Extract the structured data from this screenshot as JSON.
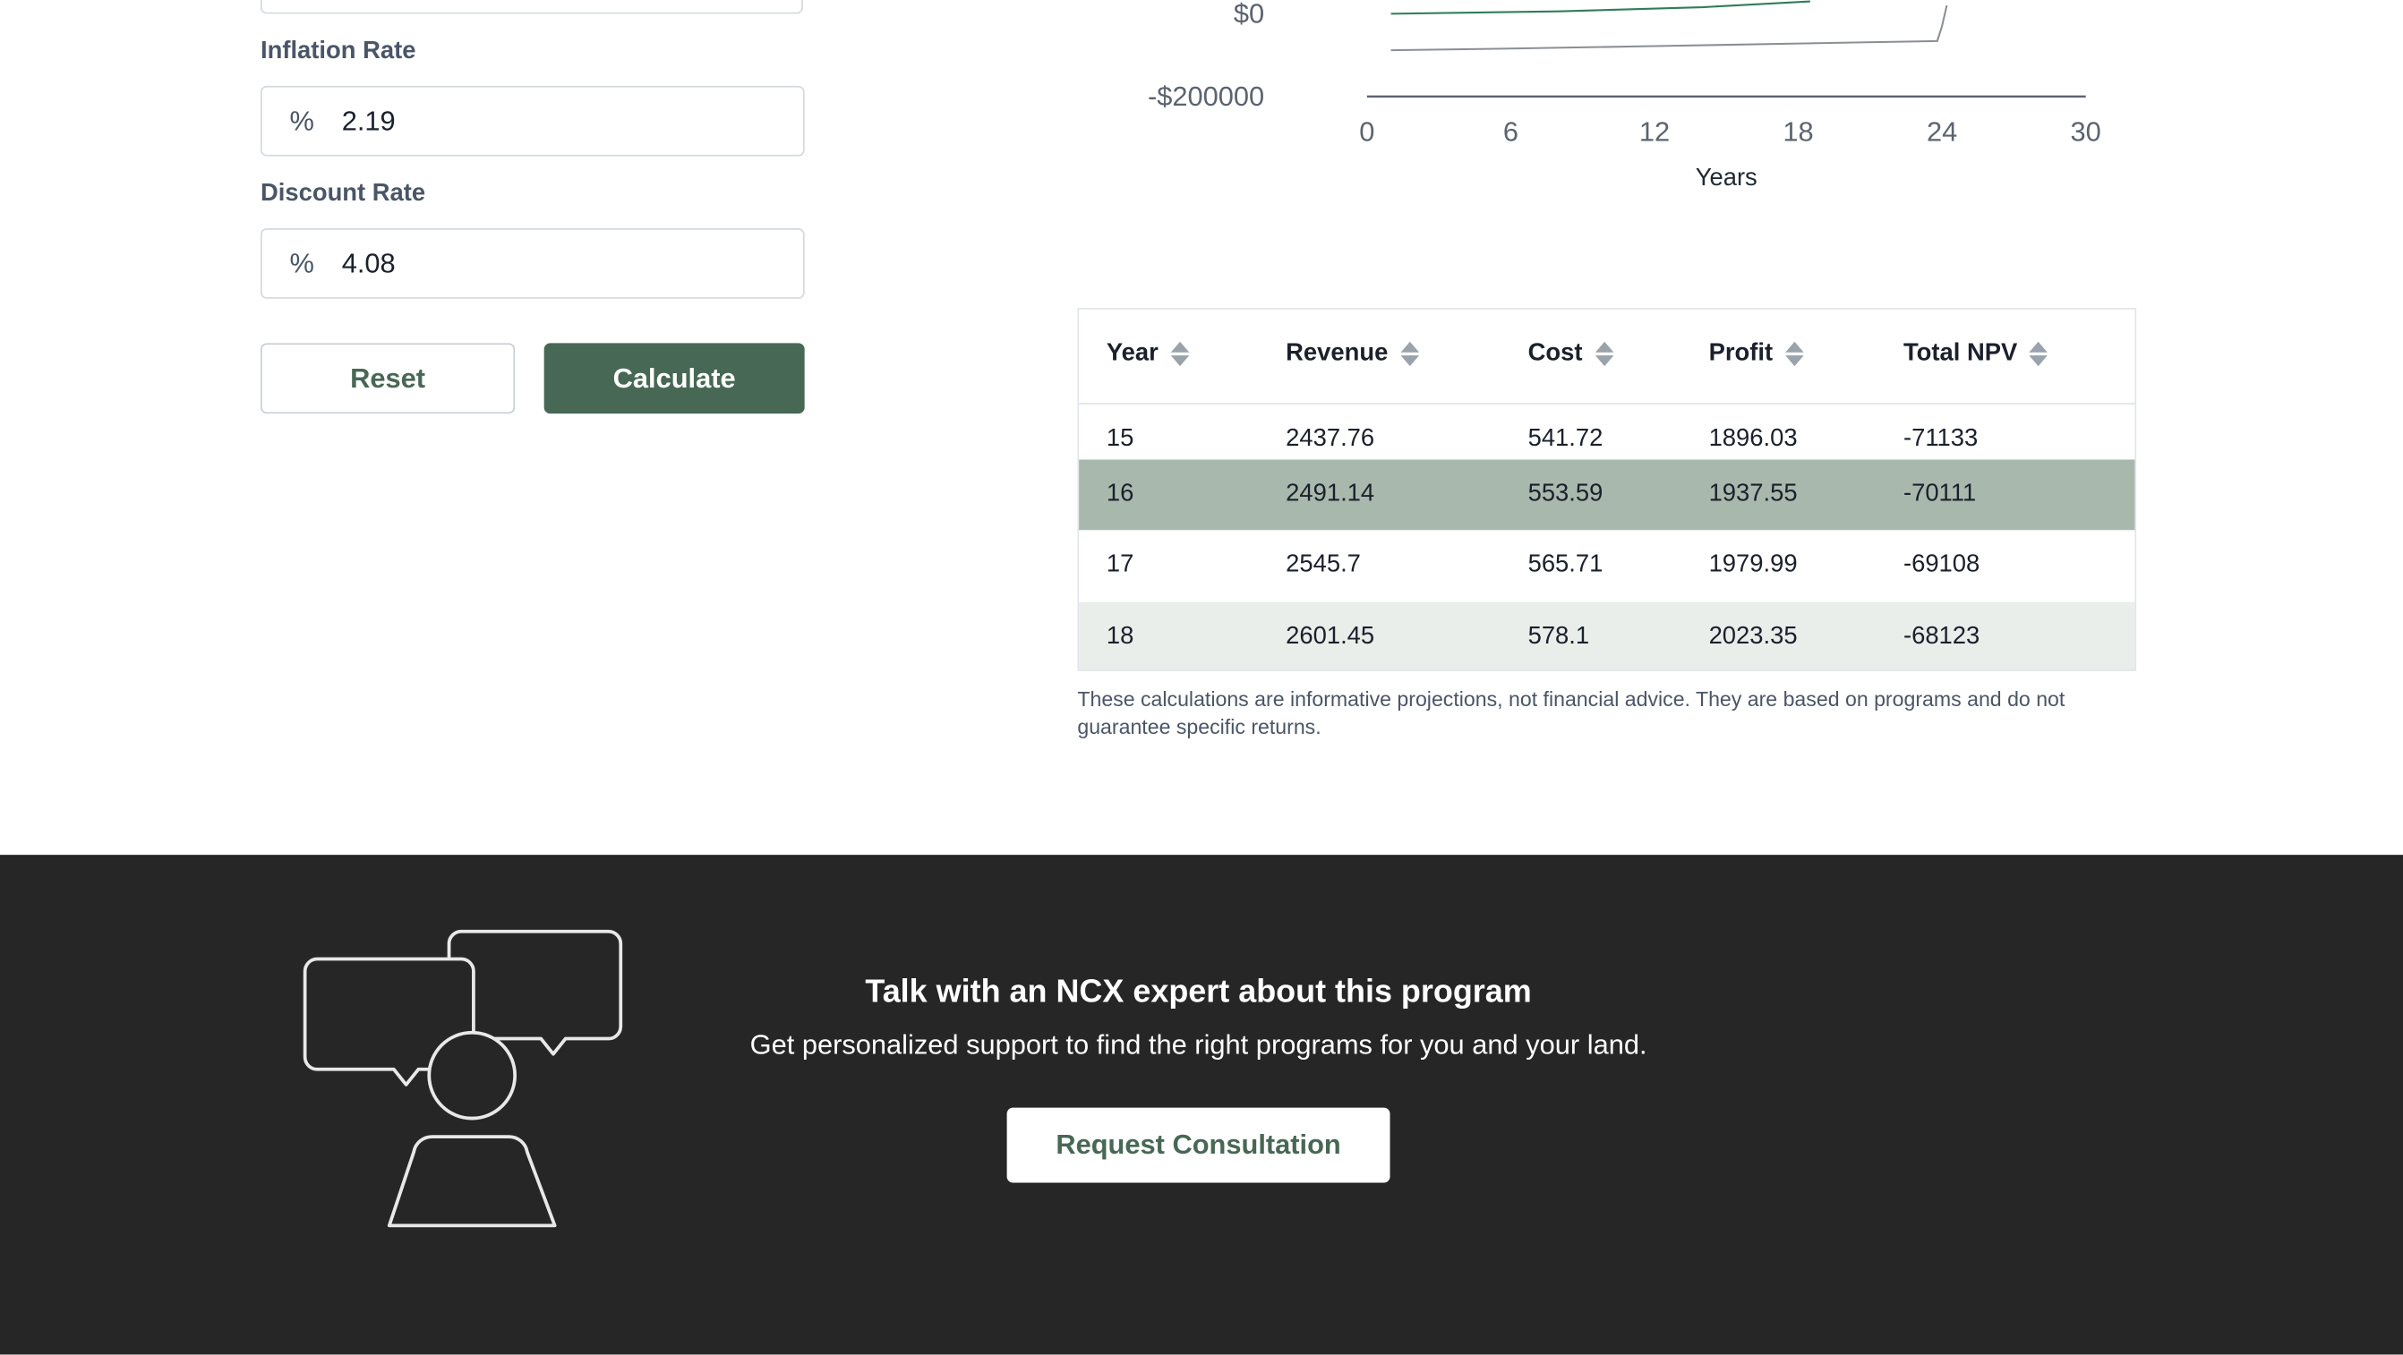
{
  "form": {
    "inflation_label": "Inflation Rate",
    "inflation_unit": "%",
    "inflation_value": "2.19",
    "discount_label": "Discount Rate",
    "discount_unit": "%",
    "discount_value": "4.08",
    "reset_label": "Reset",
    "calculate_label": "Calculate"
  },
  "chart_data": {
    "type": "line",
    "xlabel": "Years",
    "ylabel": "",
    "x_ticks": [
      "0",
      "6",
      "12",
      "18",
      "24",
      "30"
    ],
    "y_ticks_visible": [
      "$0",
      "-$200000"
    ],
    "xlim": [
      0,
      30
    ],
    "series": [
      {
        "color": "#2f7d5b",
        "x": [
          1,
          8,
          14,
          18.5
        ],
        "values": [
          0,
          6000,
          16000,
          30000
        ]
      },
      {
        "color": "#8a8f94",
        "x": [
          1,
          6,
          12,
          18,
          23.8,
          24,
          24.2
        ],
        "values": [
          -88000,
          -84000,
          -78000,
          -72000,
          -66000,
          -30000,
          20000
        ]
      }
    ]
  },
  "table": {
    "headers": [
      "Year",
      "Revenue",
      "Cost",
      "Profit",
      "Total NPV"
    ],
    "rows": [
      [
        "15",
        "2437.76",
        "541.72",
        "1896.03",
        "-71133"
      ],
      [
        "16",
        "2491.14",
        "553.59",
        "1937.55",
        "-70111"
      ],
      [
        "17",
        "2545.7",
        "565.71",
        "1979.99",
        "-69108"
      ],
      [
        "18",
        "2601.45",
        "578.1",
        "2023.35",
        "-68123"
      ]
    ],
    "row_colors": [
      "#ffffff",
      "#a9b8ad",
      "#ffffff",
      "#e9eeea"
    ]
  },
  "disclaimer": "These calculations are informative projections, not financial advice. They are based on programs and do not guarantee specific returns.",
  "footer": {
    "title": "Talk with an NCX expert about this program",
    "subtitle": "Get personalized support to find the right programs for you and your land.",
    "button_label": "Request Consultation",
    "illustration_icon": "consultation-person-speech-bubbles-icon"
  }
}
